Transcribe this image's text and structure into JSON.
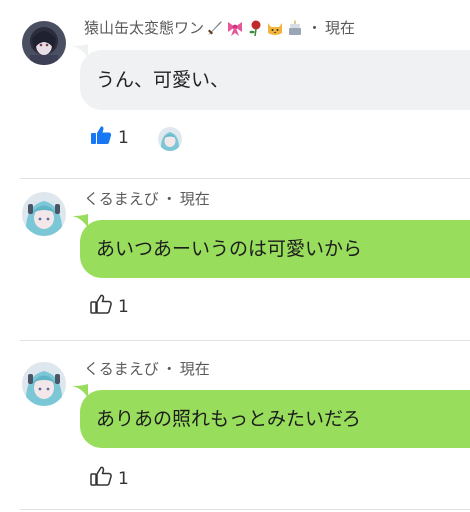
{
  "comments": [
    {
      "author": "猿山缶太変態ワン",
      "emojis": [
        "sword-icon",
        "ribbon-icon",
        "rose-icon",
        "cat-icon",
        "cake-icon"
      ],
      "separator": "・",
      "time": "現在",
      "text": "うん、可愛い、",
      "bubble_color": "#f0f1f3",
      "like_count": "1",
      "liked": true
    },
    {
      "author": "くるまえび",
      "separator": "・",
      "time": "現在",
      "text": "あいつあーいうのは可愛いから",
      "bubble_color": "#98dd5c",
      "like_count": "1",
      "liked": false
    },
    {
      "author": "くるまえび",
      "separator": "・",
      "time": "現在",
      "text": "ありあの照れもっとみたいだろ",
      "bubble_color": "#98dd5c",
      "like_count": "1",
      "liked": false
    }
  ],
  "colors": {
    "like_active": "#1877f2",
    "green_bubble": "#98dd5c",
    "gray_bubble": "#f0f1f3"
  }
}
